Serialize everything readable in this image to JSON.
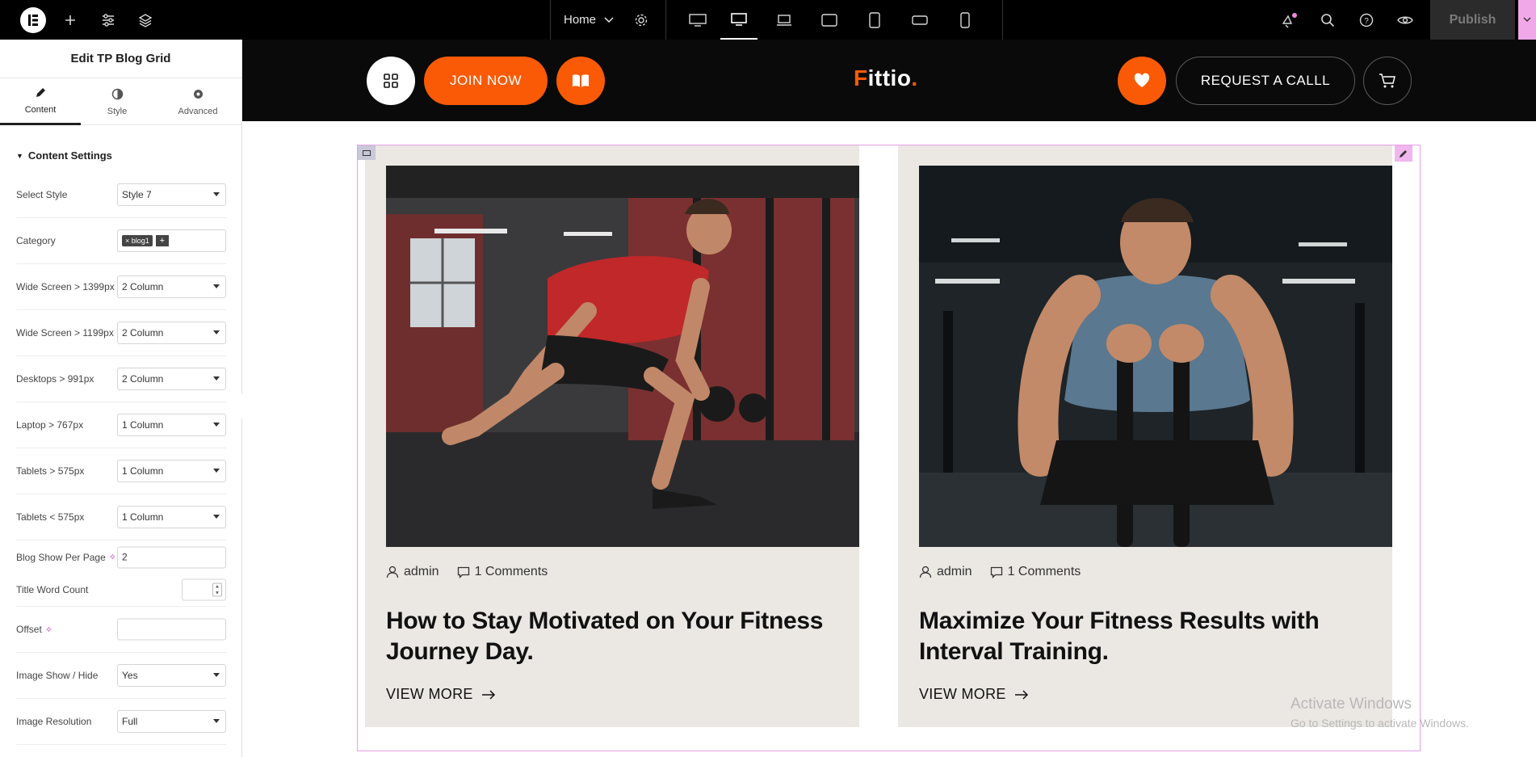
{
  "topbar": {
    "page_name": "Home",
    "publish_label": "Publish",
    "devices": [
      "desktop-wide",
      "desktop",
      "laptop",
      "tablet-landscape",
      "tablet-portrait",
      "mobile-landscape",
      "mobile-portrait"
    ],
    "active_device": "desktop"
  },
  "panel": {
    "title": "Edit TP Blog Grid",
    "tabs": [
      {
        "label": "Content",
        "icon": "pencil-icon"
      },
      {
        "label": "Style",
        "icon": "half-circle-icon"
      },
      {
        "label": "Advanced",
        "icon": "gear-icon"
      }
    ],
    "section_title": "Content Settings",
    "controls": {
      "select_style": {
        "label": "Select Style",
        "value": "Style 7"
      },
      "category": {
        "label": "Category",
        "tag": "blog1"
      },
      "wide_1399": {
        "label": "Wide Screen > 1399px",
        "value": "2 Column"
      },
      "wide_1199": {
        "label": "Wide Screen > 1199px",
        "value": "2 Column"
      },
      "desktop_991": {
        "label": "Desktops > 991px",
        "value": "2 Column"
      },
      "laptop_767": {
        "label": "Laptop > 767px",
        "value": "1 Column"
      },
      "tablet_575_up": {
        "label": "Tablets > 575px",
        "value": "1 Column"
      },
      "tablet_575_down": {
        "label": "Tablets < 575px",
        "value": "1 Column"
      },
      "per_page": {
        "label": "Blog Show Per Page",
        "value": "2"
      },
      "title_word_count": {
        "label": "Title Word Count",
        "value": ""
      },
      "offset": {
        "label": "Offset",
        "value": ""
      },
      "image_show": {
        "label": "Image Show / Hide",
        "value": "Yes"
      },
      "image_resolution": {
        "label": "Image Resolution",
        "value": "Full"
      }
    }
  },
  "site": {
    "join_label": "JOIN NOW",
    "brand_first": "F",
    "brand_rest": "ittio",
    "brand_dot": ".",
    "request_label": "REQUEST A CALLL"
  },
  "posts": [
    {
      "author": "admin",
      "comments": "1 Comments",
      "title": "How to Stay Motivated on Your Fitness Journey Day.",
      "cta": "VIEW MORE"
    },
    {
      "author": "admin",
      "comments": "1 Comments",
      "title": "Maximize Your Fitness Results with Interval Training.",
      "cta": "VIEW MORE"
    }
  ],
  "watermark": {
    "line1": "Activate Windows",
    "line2": "Go to Settings to activate Windows."
  },
  "colors": {
    "accent": "#fa5a05",
    "card_bg": "#ebe7e3",
    "editor_outline": "#e8a0e8"
  }
}
